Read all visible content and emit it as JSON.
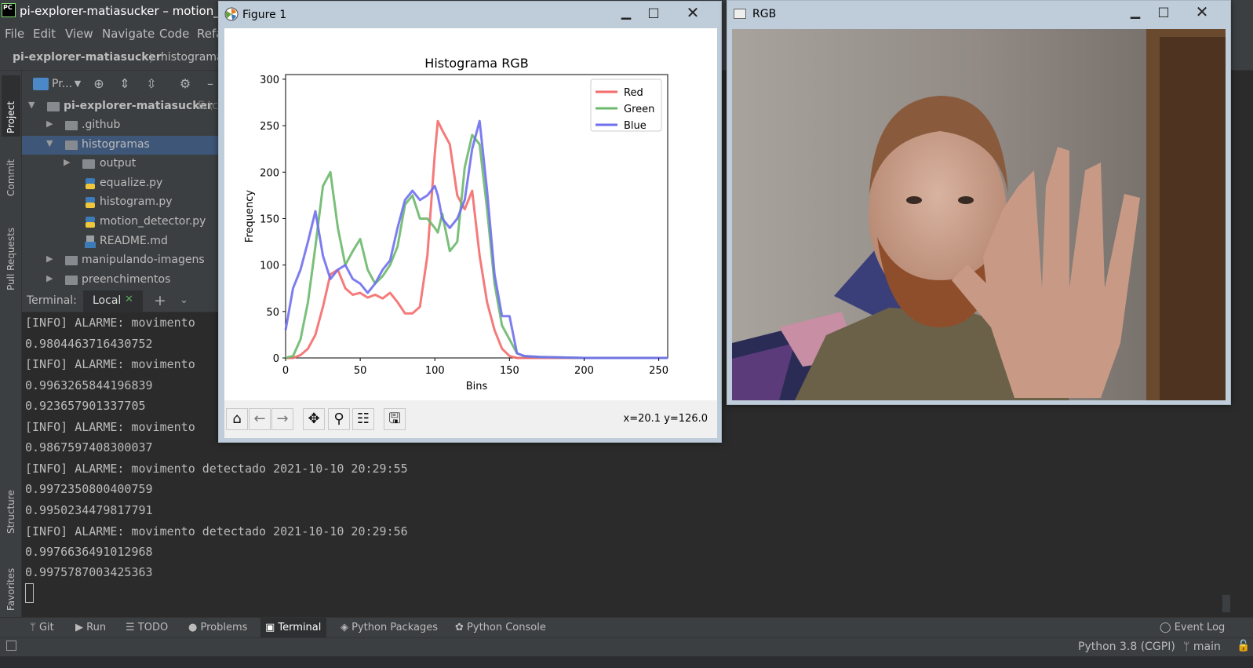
{
  "ide": {
    "title": "pi-explorer-matiasucker – motion_dete",
    "menu": [
      "File",
      "Edit",
      "View",
      "Navigate",
      "Code",
      "Refa"
    ],
    "breadcrumb": {
      "project": "pi-explorer-matiasucker",
      "folder": "histograma"
    },
    "side_tabs": {
      "project": "Project",
      "commit": "Commit",
      "pull_requests": "Pull Requests",
      "structure": "Structure",
      "favorites": "Favorites"
    },
    "project_panel": {
      "toolbar_label": "Pr...",
      "tree": [
        {
          "label": "pi-explorer-matiasucker",
          "suffix": "E:\\c",
          "type": "root",
          "expanded": true
        },
        {
          "label": ".github",
          "type": "folder",
          "expanded": false
        },
        {
          "label": "histogramas",
          "type": "folder",
          "expanded": true,
          "selected": true
        },
        {
          "label": "output",
          "type": "folder",
          "expanded": false
        },
        {
          "label": "equalize.py",
          "type": "python"
        },
        {
          "label": "histogram.py",
          "type": "python"
        },
        {
          "label": "motion_detector.py",
          "type": "python"
        },
        {
          "label": "README.md",
          "type": "markdown"
        },
        {
          "label": "manipulando-imagens",
          "type": "folder",
          "expanded": false
        },
        {
          "label": "preenchimentos",
          "type": "folder",
          "expanded": false
        }
      ]
    },
    "terminal": {
      "label": "Terminal:",
      "tab": "Local",
      "lines": [
        "[INFO] ALARME: movimento",
        "0.9804463716430752",
        "[INFO] ALARME: movimento",
        "0.9963265844196839",
        "0.923657901337705",
        "[INFO] ALARME: movimento",
        "0.9867597408300037",
        "[INFO] ALARME: movimento detectado 2021-10-10 20:29:55",
        "0.9972350800400759",
        "0.9950234479817791",
        "[INFO] ALARME: movimento detectado 2021-10-10 20:29:56",
        "0.9976636491012968",
        "0.9975787003425363"
      ]
    },
    "bottom_tabs": [
      "Git",
      "Run",
      "TODO",
      "Problems",
      "Terminal",
      "Python Packages",
      "Python Console"
    ],
    "active_bottom_tab": "Terminal",
    "event_log": "Event Log",
    "status": {
      "interpreter": "Python 3.8 (CGPI)",
      "branch": "main"
    }
  },
  "figure_window": {
    "title": "Figure 1",
    "coords": "x=20.1 y=126.0",
    "toolbar": [
      "home-icon",
      "back-icon",
      "forward-icon",
      "pan-icon",
      "zoom-icon",
      "configure-icon",
      "save-icon"
    ]
  },
  "chart_data": {
    "type": "line",
    "title": "Histograma RGB",
    "xlabel": "Bins",
    "ylabel": "Frequency",
    "xlim": [
      0,
      256
    ],
    "ylim": [
      0,
      305
    ],
    "xticks": [
      0,
      50,
      100,
      150,
      200,
      250
    ],
    "yticks": [
      0,
      50,
      100,
      150,
      200,
      250,
      300
    ],
    "legend_position": "top-right",
    "grid": false,
    "x": [
      0,
      5,
      10,
      15,
      20,
      25,
      30,
      35,
      40,
      45,
      50,
      55,
      60,
      65,
      70,
      75,
      80,
      85,
      90,
      95,
      100,
      102,
      105,
      110,
      115,
      120,
      125,
      130,
      135,
      140,
      145,
      150,
      155,
      160,
      170,
      200,
      256
    ],
    "series": [
      {
        "name": "Red",
        "color": "#f46b6b",
        "values": [
          0,
          0,
          3,
          10,
          25,
          55,
          90,
          95,
          75,
          68,
          70,
          65,
          68,
          64,
          70,
          60,
          48,
          48,
          55,
          110,
          220,
          255,
          245,
          230,
          175,
          160,
          180,
          110,
          60,
          30,
          10,
          2,
          0,
          0,
          0,
          0,
          0
        ]
      },
      {
        "name": "Green",
        "color": "#6cb86c",
        "values": [
          0,
          2,
          20,
          60,
          120,
          185,
          200,
          140,
          100,
          115,
          128,
          95,
          80,
          88,
          100,
          120,
          165,
          175,
          150,
          150,
          140,
          135,
          155,
          115,
          125,
          205,
          240,
          230,
          160,
          80,
          35,
          20,
          5,
          2,
          1,
          0,
          0
        ]
      },
      {
        "name": "Blue",
        "color": "#6f6ff0",
        "values": [
          30,
          75,
          95,
          125,
          158,
          110,
          85,
          95,
          100,
          85,
          80,
          70,
          80,
          95,
          105,
          140,
          170,
          180,
          170,
          175,
          185,
          175,
          150,
          140,
          150,
          170,
          225,
          255,
          180,
          90,
          45,
          45,
          5,
          2,
          1,
          0,
          0
        ]
      }
    ]
  },
  "rgb_window": {
    "title": "RGB"
  },
  "colors": {
    "ide_bg": "#2b2b2b",
    "panel_bg": "#3c3f41",
    "selection": "#3e5678",
    "window_chrome": "#bfcddb"
  }
}
